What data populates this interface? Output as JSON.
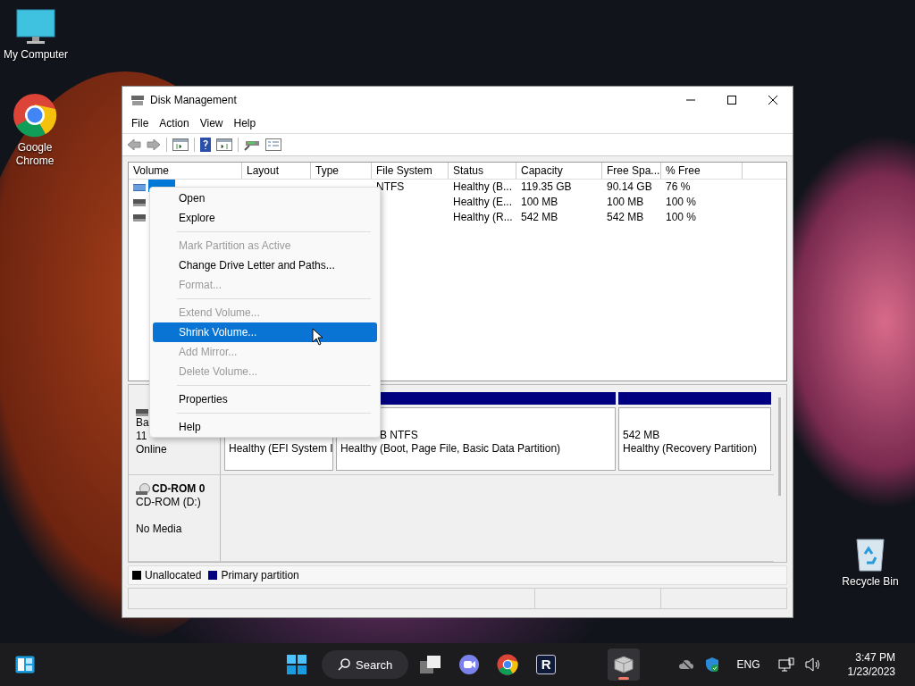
{
  "desktop_icons": [
    {
      "label": "My Computer",
      "kind": "computer"
    },
    {
      "label": "Google Chrome",
      "kind": "chrome"
    },
    {
      "label": "Recycle Bin",
      "kind": "recycle"
    }
  ],
  "window": {
    "title": "Disk Management",
    "menu": [
      "File",
      "Action",
      "View",
      "Help"
    ],
    "volume_table": {
      "columns": [
        "Volume",
        "Layout",
        "Type",
        "File System",
        "Status",
        "Capacity",
        "Free Spa...",
        "% Free"
      ],
      "rows": [
        {
          "kind": "striped",
          "selected": true,
          "file_system": "NTFS",
          "status": "Healthy (B...",
          "capacity": "119.35 GB",
          "free_space": "90.14 GB",
          "percent_free": "76 %"
        },
        {
          "kind": "plain",
          "selected": false,
          "status": "Healthy (E...",
          "capacity": "100 MB",
          "free_space": "100 MB",
          "percent_free": "100 %"
        },
        {
          "kind": "plain",
          "selected": false,
          "status": "Healthy (R...",
          "capacity": "542 MB",
          "free_space": "542 MB",
          "percent_free": "100 %"
        }
      ]
    },
    "disks": [
      {
        "kind": "disk",
        "lines": [
          "Ba",
          "11"
        ],
        "status": "Online",
        "partitions": [
          {
            "status": "Healthy (EFI System I"
          },
          {
            "size": "B NTFS",
            "status": "Healthy (Boot, Page File, Basic Data Partition)"
          },
          {
            "size": "542 MB",
            "status": "Healthy (Recovery Partition)"
          }
        ]
      },
      {
        "kind": "cdrom",
        "title": "CD-ROM 0",
        "lines": [
          "CD-ROM (D:)"
        ],
        "status": "No Media"
      }
    ],
    "legend": [
      {
        "label": "Unallocated",
        "color": "#000000"
      },
      {
        "label": "Primary partition",
        "color": "#000080"
      }
    ]
  },
  "context_menu": [
    {
      "kind": "item",
      "label": "Open",
      "disabled": false,
      "selected": false
    },
    {
      "kind": "item",
      "label": "Explore",
      "disabled": false,
      "selected": false
    },
    {
      "kind": "separator"
    },
    {
      "kind": "item",
      "label": "Mark Partition as Active",
      "disabled": true,
      "selected": false
    },
    {
      "kind": "item",
      "label": "Change Drive Letter and Paths...",
      "disabled": false,
      "selected": false
    },
    {
      "kind": "item",
      "label": "Format...",
      "disabled": true,
      "selected": false
    },
    {
      "kind": "separator"
    },
    {
      "kind": "item",
      "label": "Extend Volume...",
      "disabled": true,
      "selected": false
    },
    {
      "kind": "item",
      "label": "Shrink Volume...",
      "disabled": false,
      "selected": true
    },
    {
      "kind": "item",
      "label": "Add Mirror...",
      "disabled": true,
      "selected": false
    },
    {
      "kind": "item",
      "label": "Delete Volume...",
      "disabled": true,
      "selected": false
    },
    {
      "kind": "separator"
    },
    {
      "kind": "item",
      "label": "Properties",
      "disabled": false,
      "selected": false
    },
    {
      "kind": "separator"
    },
    {
      "kind": "item",
      "label": "Help",
      "disabled": false,
      "selected": false
    }
  ],
  "taskbar": {
    "search": "Search",
    "apps": [
      {
        "kind": "taskview",
        "active": false
      },
      {
        "kind": "meet",
        "active": false
      },
      {
        "kind": "chrome",
        "active": false
      },
      {
        "kind": "r",
        "label": "R",
        "active": false
      },
      {
        "kind": "disk",
        "active": true
      }
    ],
    "language": "ENG",
    "time": "3:47 PM",
    "date": "1/23/2023"
  }
}
